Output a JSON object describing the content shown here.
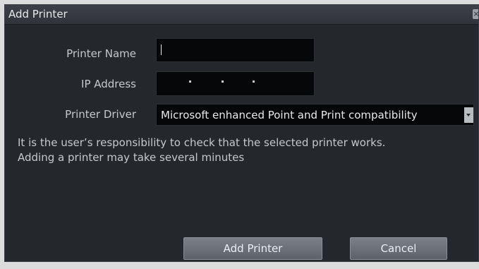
{
  "dialog": {
    "title": "Add Printer",
    "close_icon": "close-icon"
  },
  "form": {
    "printer_name_label": "Printer Name",
    "printer_name_value": "",
    "ip_address_label": "IP Address",
    "ip_address_value": ". . .",
    "printer_driver_label": "Printer Driver",
    "printer_driver_value": "Microsoft enhanced Point and Print compatibility"
  },
  "info": {
    "line1": "It is the user’s responsibility to check that the selected printer works.",
    "line2": "Adding a printer may take several minutes"
  },
  "buttons": {
    "add_label": "Add Printer",
    "cancel_label": "Cancel"
  },
  "colors": {
    "dialog_bg": "#24272b",
    "field_bg": "#060708",
    "button_bg": "#6c7177"
  }
}
